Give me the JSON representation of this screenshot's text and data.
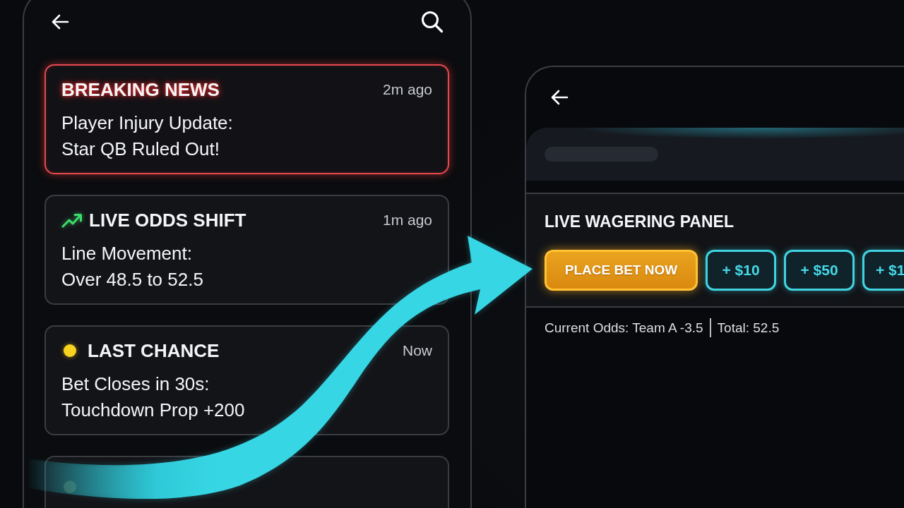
{
  "left_screen": {
    "notifications": [
      {
        "kind": "alert",
        "title": "BREAKING NEWS",
        "time": "2m ago",
        "body": "Player Injury Update:\nStar QB Ruled Out!"
      },
      {
        "kind": "trend",
        "title": "LIVE ODDS SHIFT",
        "time": "1m ago",
        "body": "Line Movement:\nOver 48.5 to 52.5"
      },
      {
        "kind": "dot",
        "title": "LAST CHANCE",
        "time": "Now",
        "body": "Bet Closes in 30s:\nTouchdown Prop +200"
      },
      {
        "kind": "faded"
      }
    ]
  },
  "right_screen": {
    "panel": {
      "title": "LIVE WAGERING PANEL",
      "buttons": [
        {
          "kind": "primary",
          "label": "PLACE BET NOW"
        },
        {
          "kind": "amount",
          "label": "+ $10"
        },
        {
          "kind": "amount",
          "label": "+ $50"
        },
        {
          "kind": "amount",
          "label": "+ $1"
        }
      ]
    },
    "odds": [
      "Current Odds: Team A -3.5",
      "Total: 52.5"
    ]
  }
}
